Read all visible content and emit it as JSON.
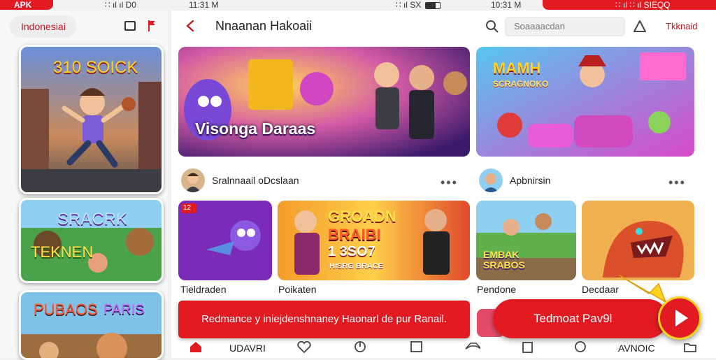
{
  "status": {
    "apk_badge": "APK",
    "left_time_icons": "∷ ıl ıl D0",
    "mid_time": "11:31 M",
    "mid_icons": "∷ ıl SX",
    "right_time": "10:31 M",
    "right_icons": "∷ ıl ∷ ıl SIEQQ"
  },
  "header": {
    "language": "Indonesiai",
    "title": "Nnaanan Hakoaii",
    "search_placeholder": "Soaaaacdan",
    "right_link": "Tkknaid"
  },
  "left_cards": [
    {
      "caption": "310 SOICK"
    },
    {
      "caption_line1": "SRACRK",
      "caption_line2": "TEKNEN"
    },
    {
      "caption_line1": "PUBAOS",
      "caption_line2": "PARIS"
    }
  ],
  "featured": [
    {
      "caption": "Visonga Daraas"
    },
    {
      "caption_line1": "MAMH",
      "caption_line2": "SCRAGNOKO"
    }
  ],
  "channels": [
    {
      "name": "Sralnnaail oDcslaan",
      "more": "•••"
    },
    {
      "name": "Apbnirsin",
      "more": "•••"
    }
  ],
  "thumbs": [
    {
      "label": "Tieldraden",
      "badge": "12"
    },
    {
      "label": "Poikaten",
      "caption_line1": "GROADN",
      "caption_line2": "BRAIBI",
      "caption_line3": "1 3SO7",
      "caption_line4": "HISRG BRACE"
    },
    {
      "label": "Pendone",
      "caption": "EMBAK SRABOS"
    },
    {
      "label": "Decdaar"
    }
  ],
  "banner_text": "Redmance y iniejdenshnaney Haonarl de pur Ranail.",
  "pay_button": "Tedmoat Pav9l",
  "bottom_nav": {
    "home_label": "UDAVRI",
    "right_label": "AVNOIC"
  },
  "colors": {
    "accent": "#e21b23",
    "highlight": "#ffd21f",
    "background": "#f1f1f1"
  },
  "icons": [
    "home-icon",
    "heart-icon",
    "bookmark-icon",
    "square-icon",
    "controller-icon",
    "building-icon",
    "chat-icon",
    "folder-icon",
    "search-icon",
    "bell-icon",
    "back-arrow-icon",
    "play-icon"
  ]
}
